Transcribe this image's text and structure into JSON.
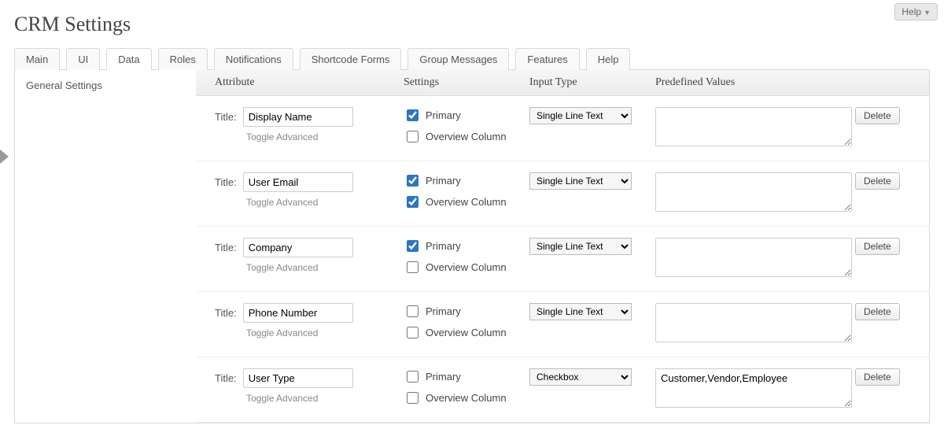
{
  "help_label": "Help",
  "page_title": "CRM Settings",
  "tabs": [
    "Main",
    "UI",
    "Data",
    "Roles",
    "Notifications",
    "Shortcode Forms",
    "Group Messages",
    "Features",
    "Help"
  ],
  "active_tab_index": 2,
  "sidebar_item": "General Settings",
  "table_headers": {
    "attribute": "Attribute",
    "settings": "Settings",
    "input_type": "Input Type",
    "predefined": "Predefined Values"
  },
  "labels": {
    "title": "Title:",
    "toggle": "Toggle Advanced",
    "primary": "Primary",
    "overview": "Overview Column",
    "delete": "Delete"
  },
  "input_type_options": [
    "Single Line Text",
    "Checkbox"
  ],
  "rows": [
    {
      "title": "Display Name",
      "primary": true,
      "overview": false,
      "input_type": "Single Line Text",
      "predefined": ""
    },
    {
      "title": "User Email",
      "primary": true,
      "overview": true,
      "input_type": "Single Line Text",
      "predefined": ""
    },
    {
      "title": "Company",
      "primary": true,
      "overview": false,
      "input_type": "Single Line Text",
      "predefined": ""
    },
    {
      "title": "Phone Number",
      "primary": false,
      "overview": false,
      "input_type": "Single Line Text",
      "predefined": ""
    },
    {
      "title": "User Type",
      "primary": false,
      "overview": false,
      "input_type": "Checkbox",
      "predefined": "Customer,Vendor,Employee"
    }
  ]
}
